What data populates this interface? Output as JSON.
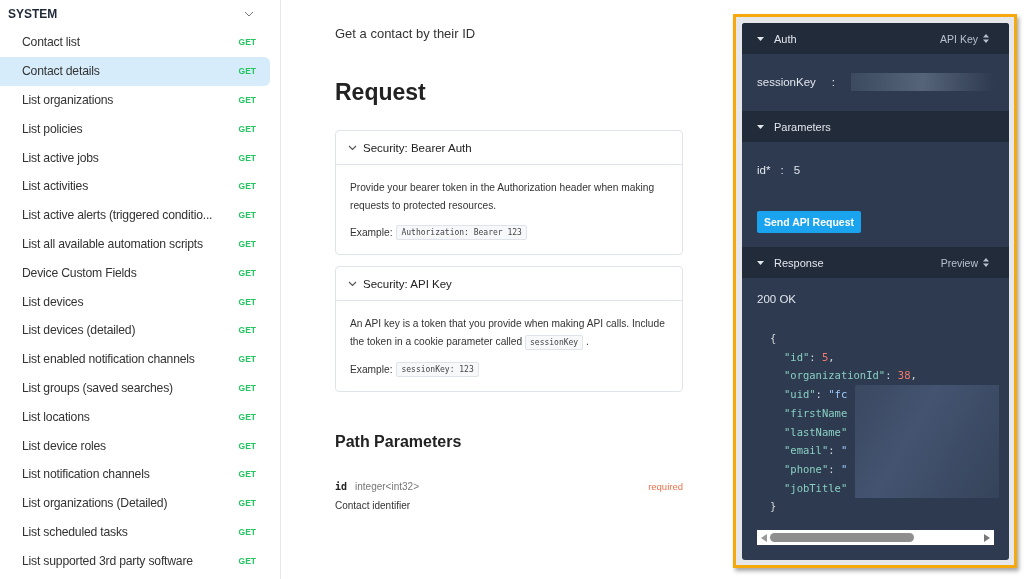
{
  "sidebar": {
    "section": {
      "title": "SYSTEM",
      "expanded": true
    },
    "items": [
      {
        "label": "Contact list",
        "method": "GET",
        "selected": false
      },
      {
        "label": "Contact details",
        "method": "GET",
        "selected": true
      },
      {
        "label": "List organizations",
        "method": "GET",
        "selected": false
      },
      {
        "label": "List policies",
        "method": "GET",
        "selected": false
      },
      {
        "label": "List active jobs",
        "method": "GET",
        "selected": false
      },
      {
        "label": "List activities",
        "method": "GET",
        "selected": false
      },
      {
        "label": "List active alerts (triggered conditio...",
        "method": "GET",
        "selected": false
      },
      {
        "label": "List all available automation scripts",
        "method": "GET",
        "selected": false
      },
      {
        "label": "Device Custom Fields",
        "method": "GET",
        "selected": false
      },
      {
        "label": "List devices",
        "method": "GET",
        "selected": false
      },
      {
        "label": "List devices (detailed)",
        "method": "GET",
        "selected": false
      },
      {
        "label": "List enabled notification channels",
        "method": "GET",
        "selected": false
      },
      {
        "label": "List groups (saved searches)",
        "method": "GET",
        "selected": false
      },
      {
        "label": "List locations",
        "method": "GET",
        "selected": false
      },
      {
        "label": "List device roles",
        "method": "GET",
        "selected": false
      },
      {
        "label": "List notification channels",
        "method": "GET",
        "selected": false
      },
      {
        "label": "List organizations (Detailed)",
        "method": "GET",
        "selected": false
      },
      {
        "label": "List scheduled tasks",
        "method": "GET",
        "selected": false
      },
      {
        "label": "List supported 3rd party software",
        "method": "GET",
        "selected": false
      }
    ]
  },
  "main": {
    "description": "Get a contact by their ID",
    "heading": "Request",
    "security": [
      {
        "title": "Security: Bearer Auth",
        "expanded": true,
        "text": "Provide your bearer token in the Authorization header when making requests to protected resources.",
        "example_label": "Example:",
        "example": "Authorization: Bearer 123"
      },
      {
        "title": "Security: API Key",
        "expanded": true,
        "text": "An API key is a token that you provide when making API calls. Include the token in a cookie parameter called",
        "code": "sessionKey",
        "text_end": ".",
        "example_label": "Example:",
        "example": "sessionKey: 123"
      }
    ],
    "path_parameters": {
      "heading": "Path Parameters",
      "params": [
        {
          "name": "id",
          "type": "integer<int32>",
          "required": "required",
          "description": "Contact identifier"
        }
      ]
    }
  },
  "console": {
    "auth": {
      "title": "Auth",
      "mode": "API Key",
      "field_label": "sessionKey",
      "separator": ":"
    },
    "parameters": {
      "title": "Parameters",
      "fields": [
        {
          "label": "id*",
          "separator": ":",
          "value": "5"
        }
      ]
    },
    "send_button": "Send API Request",
    "response": {
      "title": "Response",
      "mode": "Preview",
      "status": "200 OK",
      "lines": [
        [
          {
            "kind": "punct",
            "text": "{"
          }
        ],
        [
          {
            "kind": "key",
            "text": "\"id\""
          },
          {
            "kind": "punct",
            "text": ": "
          },
          {
            "kind": "number",
            "text": "5"
          },
          {
            "kind": "punct",
            "text": ","
          }
        ],
        [
          {
            "kind": "key",
            "text": "\"organizationId\""
          },
          {
            "kind": "punct",
            "text": ": "
          },
          {
            "kind": "number",
            "text": "38"
          },
          {
            "kind": "punct",
            "text": ","
          }
        ],
        [
          {
            "kind": "key",
            "text": "\"uid\""
          },
          {
            "kind": "punct",
            "text": ": "
          },
          {
            "kind": "string",
            "text": "\"fc"
          }
        ],
        [
          {
            "kind": "key",
            "text": "\"firstName"
          }
        ],
        [
          {
            "kind": "key",
            "text": "\"lastName\""
          }
        ],
        [
          {
            "kind": "key",
            "text": "\"email\""
          },
          {
            "kind": "punct",
            "text": ": "
          },
          {
            "kind": "string",
            "text": "\""
          }
        ],
        [
          {
            "kind": "key",
            "text": "\"phone\""
          },
          {
            "kind": "punct",
            "text": ": "
          },
          {
            "kind": "string",
            "text": "\""
          }
        ],
        [
          {
            "kind": "key",
            "text": "\"jobTitle\""
          }
        ],
        [
          {
            "kind": "punct",
            "text": "}"
          }
        ]
      ]
    }
  }
}
